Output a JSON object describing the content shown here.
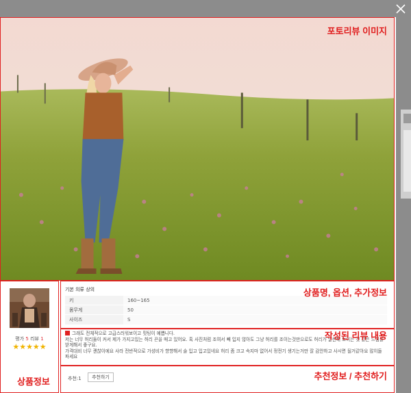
{
  "annotations": {
    "photo": "포토리뷰 이미지",
    "product": "상품정보",
    "info": "상품명, 옵션, 추가정보",
    "review": "작성된 리뷰 내용",
    "recommend": "추천정보 / 추천하기"
  },
  "product": {
    "rating_prefix": "평가",
    "rating_value": "5",
    "review_prefix": "리뷰",
    "review_count": "1",
    "stars": "★★★★★"
  },
  "info": {
    "title": "기본 의류 상의",
    "rows": [
      {
        "key": "키",
        "value": "160~165"
      },
      {
        "key": "몸무게",
        "value": "50"
      },
      {
        "key": "사이즈",
        "value": "S"
      }
    ]
  },
  "review": {
    "line1": "그래도 전체적으로 고급스러워보이고 핏팅이 예쁩니다.",
    "line2": "저는 너무 허리둘이 커서 제가 가지고있는 허리 끈을 매고 있어요. 혹 사진처럼 조여서 빼 입지 않아도 그냥 허리를 조이는것만으로도 허리가 날씬해 보이는 것 같은 느낌을 받게해서 좋구요.",
    "line3": "가격대비 너무 괜찮이에요 사라 전반적으로 가성비가 향향해서 술 입고 입고있네요 허리 좀 크고 속지마 없어서 정전기 생기는거만 잘 감안하고 사시면 될거같아요 많이들 파세요"
  },
  "recommend": {
    "count_label": "추천:1",
    "button_label": "추천하기"
  },
  "colors": {
    "annotation": "#e01c1c",
    "star": "#f0b400"
  },
  "icons": {
    "close": "close-icon"
  }
}
